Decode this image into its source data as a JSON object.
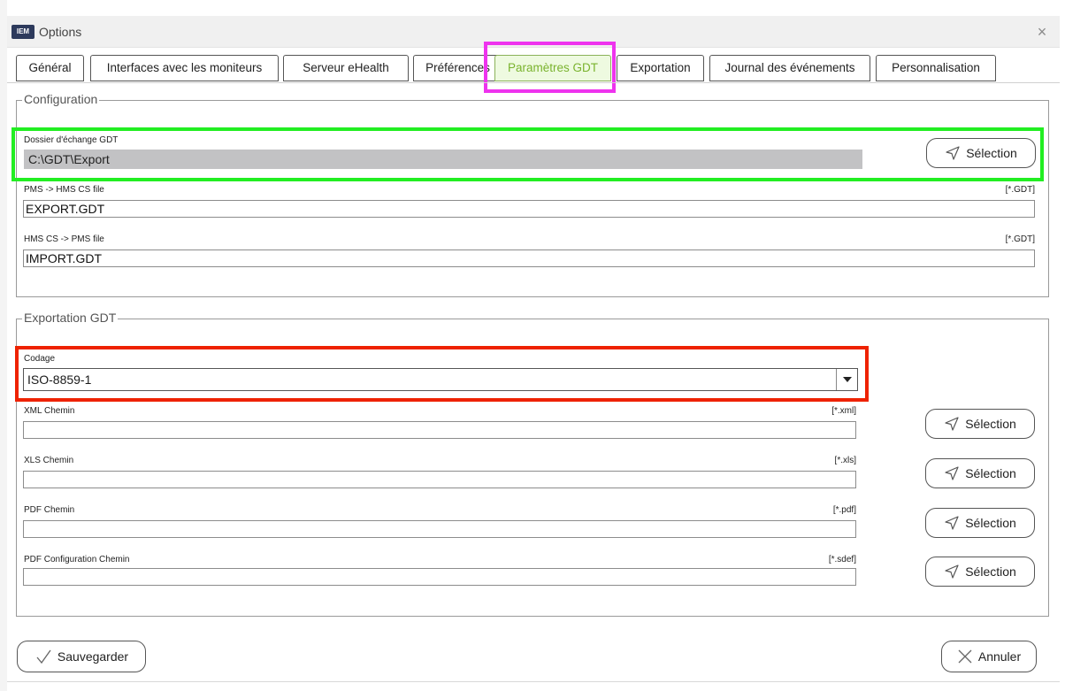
{
  "window": {
    "logo": "IEM",
    "title": "Options",
    "close_symbol": "×"
  },
  "tabs": [
    {
      "label": "Général",
      "active": false
    },
    {
      "label": "Interfaces avec les moniteurs",
      "active": false
    },
    {
      "label": "Serveur eHealth",
      "active": false
    },
    {
      "label": "Préférences",
      "active": false
    },
    {
      "label": "Paramètres GDT",
      "active": true
    },
    {
      "label": "Exportation",
      "active": false
    },
    {
      "label": "Journal des événements",
      "active": false
    },
    {
      "label": "Personnalisation",
      "active": false
    }
  ],
  "configuration": {
    "title": "Configuration",
    "exchange_folder": {
      "label": "Dossier d'échange GDT",
      "value": "C:\\GDT\\Export",
      "button": "Sélection"
    },
    "pms_to_hms": {
      "label": "PMS -> HMS CS file",
      "ext": "[*.GDT]",
      "value": "EXPORT.GDT"
    },
    "hms_to_pms": {
      "label": "HMS CS -> PMS file",
      "ext": "[*.GDT]",
      "value": "IMPORT.GDT"
    }
  },
  "export_gdt": {
    "title": "Exportation GDT",
    "codage": {
      "label": "Codage",
      "value": "ISO-8859-1"
    },
    "xml": {
      "label": "XML Chemin",
      "ext": "[*.xml]",
      "value": "",
      "button": "Sélection"
    },
    "xls": {
      "label": "XLS Chemin",
      "ext": "[*.xls]",
      "value": "",
      "button": "Sélection"
    },
    "pdf": {
      "label": "PDF Chemin",
      "ext": "[*.pdf]",
      "value": "",
      "button": "Sélection"
    },
    "pdf_config": {
      "label": "PDF Configuration Chemin",
      "ext": "[*.sdef]",
      "value": "",
      "button": "Sélection"
    }
  },
  "footer": {
    "save": "Sauvegarder",
    "cancel": "Annuler"
  },
  "colors": {
    "active_tab_text": "#7ab32e",
    "highlight_tab": "#ee33ee",
    "highlight_folder": "#22ee22",
    "highlight_codage": "#ee2200"
  }
}
